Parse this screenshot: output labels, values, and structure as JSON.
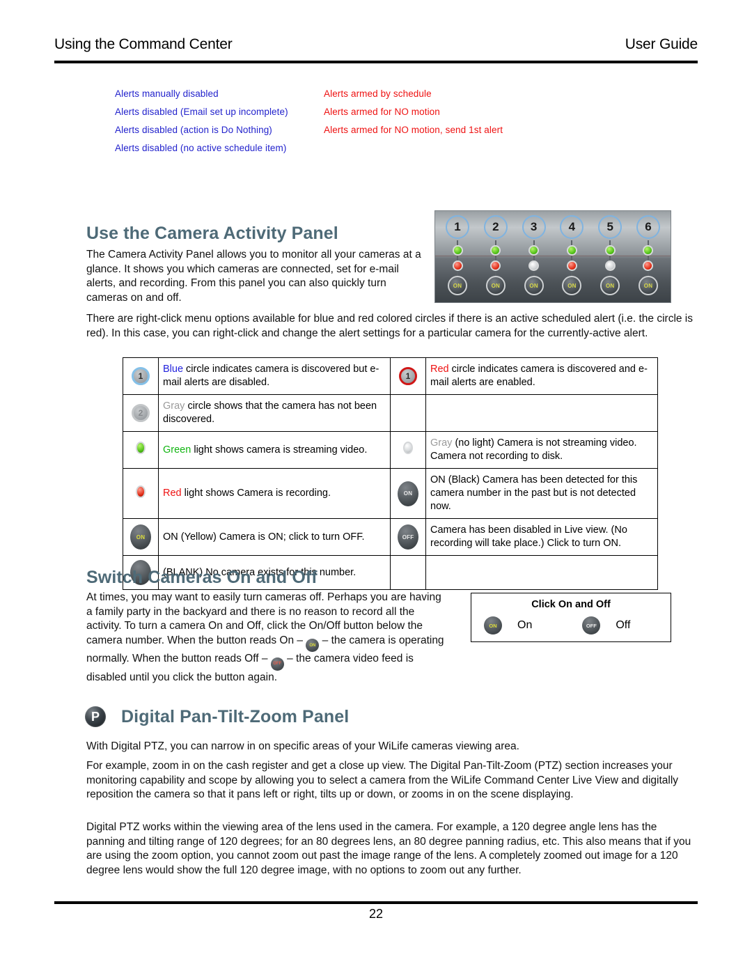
{
  "header": {
    "left_title": "Using the Command Center",
    "right_title": "User Guide"
  },
  "alert_legend": {
    "blue_color": "#2222cc",
    "red_color": "#ee1111",
    "blue_items": [
      "Alerts manually disabled",
      "Alerts disabled (Email set up incomplete)",
      "Alerts disabled (action is Do Nothing)",
      "Alerts disabled (no active schedule item)"
    ],
    "red_items": [
      "Alerts armed by schedule",
      "Alerts armed for NO motion",
      "Alerts armed for NO motion, send 1st alert"
    ]
  },
  "activity_section": {
    "heading": "Use the Camera Activity Panel",
    "paragraph": "The Camera Activity Panel allows you to monitor all your cameras at a glance. It shows you which cameras are connected, set for e-mail alerts, and recording. From this panel you can also quickly turn cameras on and off.",
    "paragraph2": "There are right-click menu options available for blue and red colored circles if there is an active scheduled alert (i.e. the circle is red).  In this case, you can right-click and change the alert settings for a particular camera for the currently-active alert."
  },
  "camera_panel": {
    "heading_color": "#4e6a77",
    "on_button_label": "ON",
    "cameras": [
      {
        "number": "1",
        "stream_led": "green",
        "record_led": "red",
        "button": "ON"
      },
      {
        "number": "2",
        "stream_led": "green",
        "record_led": "red",
        "button": "ON"
      },
      {
        "number": "3",
        "stream_led": "green",
        "record_led": "off",
        "button": "ON"
      },
      {
        "number": "4",
        "stream_led": "green",
        "record_led": "red",
        "button": "ON"
      },
      {
        "number": "5",
        "stream_led": "green",
        "record_led": "off",
        "button": "ON"
      },
      {
        "number": "6",
        "stream_led": "green",
        "record_led": "red",
        "button": "ON"
      }
    ]
  },
  "legend_table": {
    "rows": [
      {
        "left": {
          "icon": "blue-numbered-circle-icon",
          "icon_label": "1",
          "color_word": "Blue",
          "color_hex": "#2222dd",
          "text": " circle indicates camera is discovered but e-mail alerts are disabled."
        },
        "right": {
          "icon": "red-numbered-circle-icon",
          "icon_label": "1",
          "color_word": "Red",
          "color_hex": "#ee1111",
          "text": " circle indicates camera is discovered and e-mail alerts are enabled."
        }
      },
      {
        "left": {
          "icon": "gray-numbered-circle-icon",
          "icon_label": "2",
          "color_word": "Gray",
          "color_hex": "#9a9a9a",
          "text": " circle shows that the camera has not been discovered."
        },
        "right": null
      },
      {
        "left": {
          "icon": "green-led-icon",
          "icon_label": "",
          "color_word": "Green",
          "color_hex": "#12b512",
          "text": " light shows camera is streaming video."
        },
        "right": {
          "icon": "gray-led-icon",
          "icon_label": "",
          "color_word": "Gray",
          "color_hex": "#9a9a9a",
          "text": " (no light) Camera is not streaming video. Camera not recording to disk."
        }
      },
      {
        "left": {
          "icon": "red-led-icon",
          "icon_label": "",
          "color_word": "Red",
          "color_hex": "#ee1111",
          "text": " light shows Camera is recording."
        },
        "right": {
          "icon": "on-black-button-icon",
          "icon_label": "ON",
          "color_word": "",
          "color_hex": "#000000",
          "text": "ON (Black) Camera has been detected for this camera number in the past but is not detected now."
        }
      },
      {
        "left": {
          "icon": "on-yellow-button-icon",
          "icon_label": "ON",
          "color_word": "",
          "color_hex": "#000000",
          "text": "ON (Yellow) Camera is ON; click to turn OFF."
        },
        "right": {
          "icon": "off-button-icon",
          "icon_label": "OFF",
          "color_word": "",
          "color_hex": "#000000",
          "text": "Camera has been disabled in Live view. (No recording will take place.)  Click to turn ON."
        }
      },
      {
        "left": {
          "icon": "blank-button-icon",
          "icon_label": "",
          "color_word": "",
          "color_hex": "#000000",
          "text": "(BLANK) No camera exists for this number."
        },
        "right": null
      }
    ]
  },
  "switch_section": {
    "heading": "Switch Cameras On and Off",
    "text_a": "At times, you may want to easily turn cameras off. Perhaps you are having a family party in the backyard and there is no reason to record all the activity. To turn a camera On and Off, click the On/Off button below the camera number. When the button reads On – ",
    "on_icon_label": "ON",
    "text_b": " – the camera is operating normally. When the button reads Off – ",
    "off_icon_label": "OFF",
    "text_c": " – the camera video feed is disabled until you click the button again."
  },
  "click_box": {
    "title": "Click On and Off",
    "on_button_label": "ON",
    "on_label": "On",
    "off_button_label": "OFF",
    "off_label": "Off"
  },
  "ptz_section": {
    "icon_label": "P",
    "heading": "Digital Pan-Tilt-Zoom Panel",
    "p1": "With Digital PTZ, you can narrow in on specific areas of your WiLife cameras viewing area.",
    "p2": "For example, zoom in on the cash register and get a close up view. The Digital Pan-Tilt-Zoom (PTZ) section increases your monitoring capability and scope by allowing you to select a camera from the WiLife Command Center Live View and digitally reposition the camera so that it pans left or right, tilts up or down, or zooms in on the scene displaying.",
    "p3": "Digital PTZ works within the viewing area of the lens used in the camera. For example, a 120 degree angle lens has the panning and tilting range of 120 degrees; for an 80 degrees lens, an 80 degree panning radius, etc. This also means that if you are using the zoom option, you cannot zoom out past the image range of the lens. A completely zoomed out image for a 120 degree lens would show the full 120 degree image, with no options to zoom out any further."
  },
  "footer": {
    "page_number": "22"
  }
}
